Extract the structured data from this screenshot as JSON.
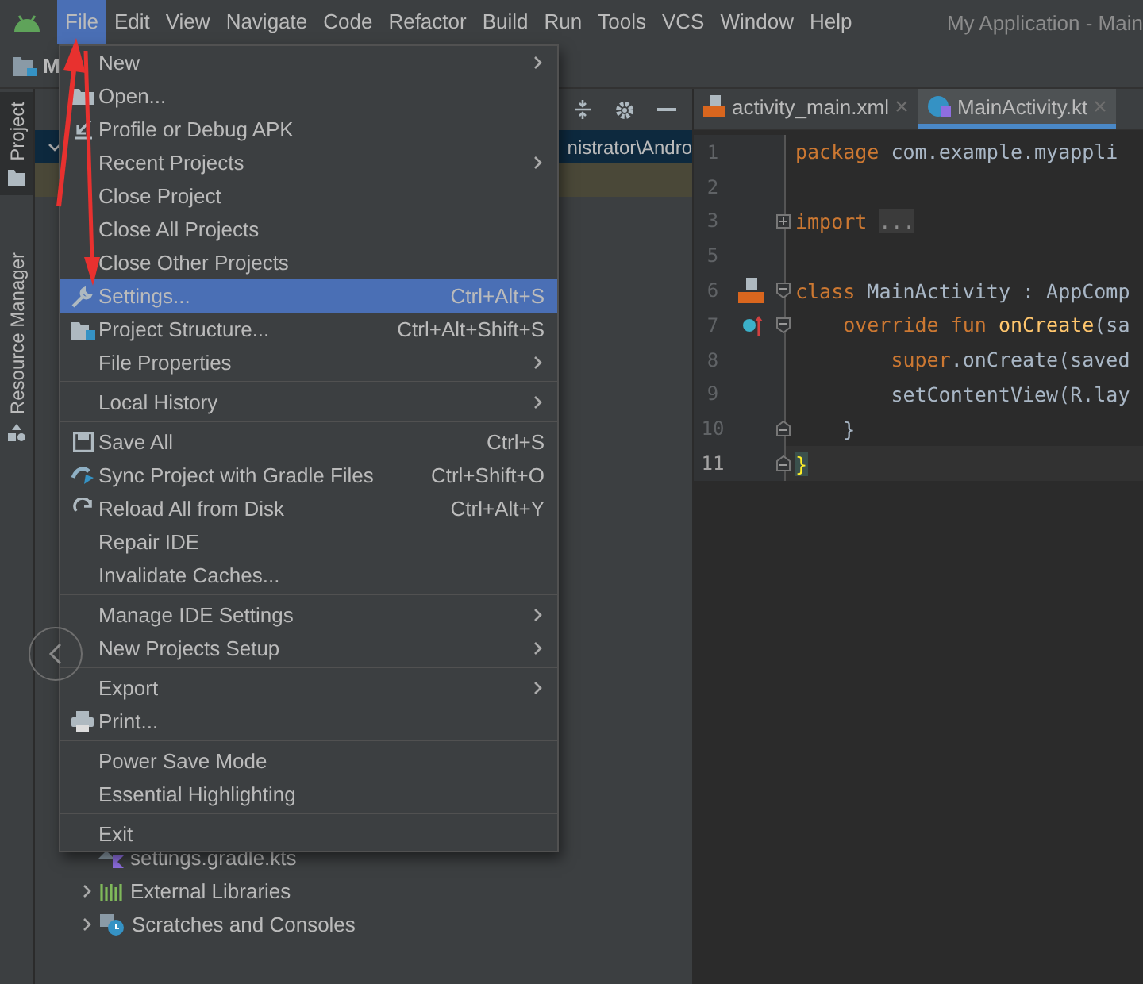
{
  "menu_bar": {
    "items": [
      {
        "label": "File",
        "selected": true
      },
      {
        "label": "Edit",
        "selected": false
      },
      {
        "label": "View",
        "selected": false
      },
      {
        "label": "Navigate",
        "selected": false
      },
      {
        "label": "Code",
        "selected": false
      },
      {
        "label": "Refactor",
        "selected": false
      },
      {
        "label": "Build",
        "selected": false
      },
      {
        "label": "Run",
        "selected": false
      },
      {
        "label": "Tools",
        "selected": false
      },
      {
        "label": "VCS",
        "selected": false
      },
      {
        "label": "Window",
        "selected": false
      },
      {
        "label": "Help",
        "selected": false
      }
    ],
    "title": "My Application - Main"
  },
  "nav_bar": {
    "crumb": "M"
  },
  "tool_stripe": [
    {
      "label": "Project",
      "selected": true
    },
    {
      "label": "Resource Manager",
      "selected": false
    }
  ],
  "project_tree": {
    "top_rows": [
      {
        "text": "nistrator\\Andro",
        "selected": true,
        "expanded": true
      },
      {
        "selected": false
      }
    ],
    "bottom_rows": [
      {
        "text": "settings.gradle.kts",
        "kind": "file"
      },
      {
        "text": "External Libraries",
        "kind": "folder",
        "expanded": false
      },
      {
        "text": "Scratches and Consoles",
        "kind": "folder",
        "expanded": false
      }
    ]
  },
  "editor": {
    "tabs": [
      {
        "label": "activity_main.xml",
        "selected": false
      },
      {
        "label": "MainActivity.kt",
        "selected": true
      }
    ],
    "lines": [
      {
        "number": "1",
        "current": false,
        "tokens": [
          {
            "text": "package",
            "kind": "keyword"
          },
          {
            "text": " com.example.myappli",
            "kind": "plain"
          }
        ]
      },
      {
        "number": "2",
        "current": false
      },
      {
        "number": "3",
        "current": false,
        "fold": {
          "kind": "collapsed"
        },
        "tokens": [
          {
            "text": "import",
            "kind": "keyword"
          },
          {
            "text": "...",
            "kind": "folded"
          }
        ]
      },
      {
        "number": "5",
        "current": false
      },
      {
        "number": "6",
        "current": false,
        "fold": {
          "kind": "open"
        },
        "tokens": [
          {
            "text": "class",
            "kind": "keyword"
          },
          {
            "text": " MainActivity : AppComp",
            "kind": "plain"
          }
        ]
      },
      {
        "number": "7",
        "current": false,
        "fold": {
          "kind": "open"
        },
        "tokens": [
          {
            "text": "    override fun ",
            "kind": "keyword"
          },
          {
            "text": "onCreate",
            "kind": "function"
          },
          {
            "text": "(sa",
            "kind": "plain"
          }
        ]
      },
      {
        "number": "8",
        "current": false,
        "tokens": [
          {
            "text": "        super",
            "kind": "keyword"
          },
          {
            "text": ".onCreate(saved",
            "kind": "plain"
          }
        ]
      },
      {
        "number": "9",
        "current": false,
        "tokens": [
          {
            "text": "        setContentView(R.lay",
            "kind": "plain"
          }
        ]
      },
      {
        "number": "10",
        "current": false,
        "fold": {
          "kind": "close"
        },
        "tokens": [
          {
            "text": "    }",
            "kind": "plain"
          }
        ]
      },
      {
        "number": "11",
        "current": true,
        "fold": {
          "kind": "close"
        },
        "tokens": [
          {
            "text": "}",
            "kind": "match"
          }
        ]
      }
    ]
  },
  "file_menu": {
    "groups": [
      [
        {
          "label": "New",
          "submenu": true,
          "selected": false
        },
        {
          "label": "Open...",
          "submenu": false,
          "selected": false
        },
        {
          "label": "Profile or Debug APK",
          "submenu": false,
          "selected": false
        },
        {
          "label": "Recent Projects",
          "submenu": true,
          "selected": false
        },
        {
          "label": "Close Project",
          "submenu": false,
          "selected": false
        },
        {
          "label": "Close All Projects",
          "submenu": false,
          "selected": false
        },
        {
          "label": "Close Other Projects",
          "submenu": false,
          "selected": false
        },
        {
          "label": "Settings...",
          "shortcut": "Ctrl+Alt+S",
          "submenu": false,
          "selected": true
        },
        {
          "label": "Project Structure...",
          "shortcut": "Ctrl+Alt+Shift+S",
          "submenu": false,
          "selected": false
        },
        {
          "label": "File Properties",
          "submenu": true,
          "selected": false
        }
      ],
      [
        {
          "label": "Local History",
          "submenu": true,
          "selected": false
        }
      ],
      [
        {
          "label": "Save All",
          "shortcut": "Ctrl+S",
          "submenu": false,
          "selected": false
        },
        {
          "label": "Sync Project with Gradle Files",
          "shortcut": "Ctrl+Shift+O",
          "submenu": false,
          "selected": false
        },
        {
          "label": "Reload All from Disk",
          "shortcut": "Ctrl+Alt+Y",
          "submenu": false,
          "selected": false
        },
        {
          "label": "Repair IDE",
          "submenu": false,
          "selected": false
        },
        {
          "label": "Invalidate Caches...",
          "submenu": false,
          "selected": false
        }
      ],
      [
        {
          "label": "Manage IDE Settings",
          "submenu": true,
          "selected": false
        },
        {
          "label": "New Projects Setup",
          "submenu": true,
          "selected": false
        }
      ],
      [
        {
          "label": "Export",
          "submenu": true,
          "selected": false
        },
        {
          "label": "Print...",
          "submenu": false,
          "selected": false
        }
      ],
      [
        {
          "label": "Power Save Mode",
          "submenu": false,
          "selected": false
        },
        {
          "label": "Essential Highlighting",
          "submenu": false,
          "selected": false
        }
      ],
      [
        {
          "label": "Exit",
          "submenu": false,
          "selected": false
        }
      ]
    ]
  }
}
